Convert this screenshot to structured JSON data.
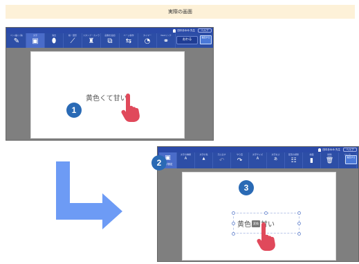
{
  "banner": {
    "text": "実際の画面"
  },
  "colors": {
    "banner_bg": "#fdf1d8",
    "toolbar": "#2d4ea6",
    "badge": "#2a6ab5",
    "arrow": "#6d9bf5",
    "hand": "#e0495b"
  },
  "step1": {
    "badge": "1",
    "user_name": "田中あゆみ 先生",
    "help_label": "ヘルプ",
    "toolbar": [
      {
        "label": "ペン(描く/消)",
        "icon": "pen-icon"
      },
      {
        "label": "文字",
        "icon": "text-icon"
      },
      {
        "label": "消去",
        "icon": "eraser-icon"
      },
      {
        "label": "線・図形",
        "icon": "line-icon"
      },
      {
        "label": "スタンプ・カメラ",
        "icon": "stamp-icon"
      },
      {
        "label": "画像を追加",
        "icon": "image-icon"
      },
      {
        "label": "ページ操作",
        "icon": "page-icon"
      },
      {
        "label": "タイマー",
        "icon": "timer-icon"
      },
      {
        "label": "Webリンク",
        "icon": "link-icon"
      }
    ],
    "ok_label": "おわる",
    "end_label": "提出する",
    "slide_text": "黄色くて甘い"
  },
  "step2": {
    "badge": "2",
    "user_name": "田中あゆみ 先生",
    "help_label": "ヘルプ",
    "tab_label": "文字設定",
    "toolbar": [
      {
        "label": "文字の種類",
        "icon": "font-icon",
        "sub": "A"
      },
      {
        "label": "文字の色",
        "icon": "color-icon",
        "sub": "▲"
      },
      {
        "label": "元に戻す",
        "icon": "undo-icon"
      },
      {
        "label": "やり直",
        "icon": "redo-icon"
      },
      {
        "label": "文字サイズ",
        "icon": "size-icon",
        "sub": "A"
      },
      {
        "label": "文字太さ",
        "icon": "bold-icon",
        "sub": "あ"
      },
      {
        "label": "配置の調整",
        "icon": "align-icon"
      },
      {
        "label": "前面",
        "icon": "front-icon"
      },
      {
        "label": "削除",
        "icon": "delete-icon"
      },
      {
        "label": "ロック",
        "icon": "lock-icon"
      }
    ],
    "end_label": "提出する"
  },
  "step3": {
    "badge": "3",
    "text_before": "黄色",
    "ime_text": "変換",
    "text_after": "甘い"
  }
}
